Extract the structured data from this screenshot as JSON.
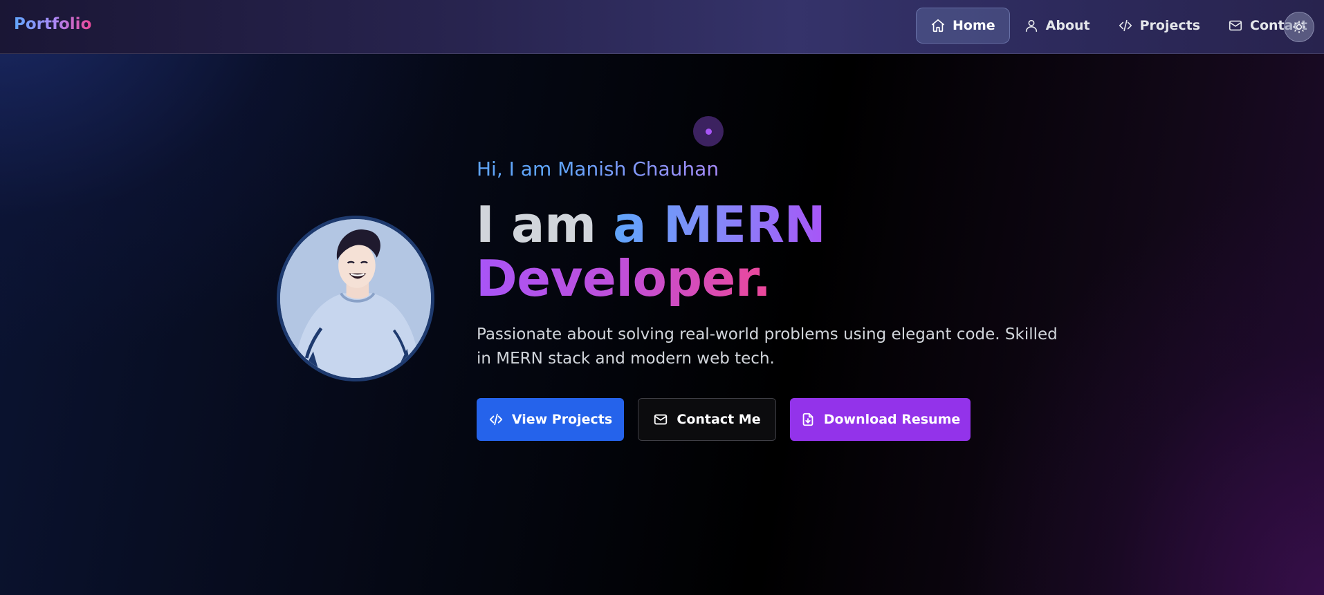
{
  "nav": {
    "brand": "Portfolio",
    "items": [
      {
        "label": "Home",
        "icon": "home-icon",
        "active": true
      },
      {
        "label": "About",
        "icon": "user-icon",
        "active": false
      },
      {
        "label": "Projects",
        "icon": "code-icon",
        "active": false
      },
      {
        "label": "Contact",
        "icon": "mail-icon",
        "active": false
      }
    ],
    "theme_toggle_icon": "sun-icon"
  },
  "hero": {
    "greeting_prefix": "Hi, I am",
    "name": "Manish Chauhan",
    "headline_line1_a": "I am",
    "headline_line1_b": "a MERN",
    "headline_line2": "Developer.",
    "description": "Passionate about solving real-world problems using elegant code. Skilled in MERN stack and modern web tech.",
    "avatar_alt": "Manish Chauhan avatar",
    "buttons": {
      "projects": "View Projects",
      "contact": "Contact Me",
      "resume": "Download Resume"
    }
  },
  "colors": {
    "primary_blue": "#2563eb",
    "accent_purple": "#9333ea",
    "accent_pink": "#ec4899",
    "text_light": "#d1d5db"
  }
}
